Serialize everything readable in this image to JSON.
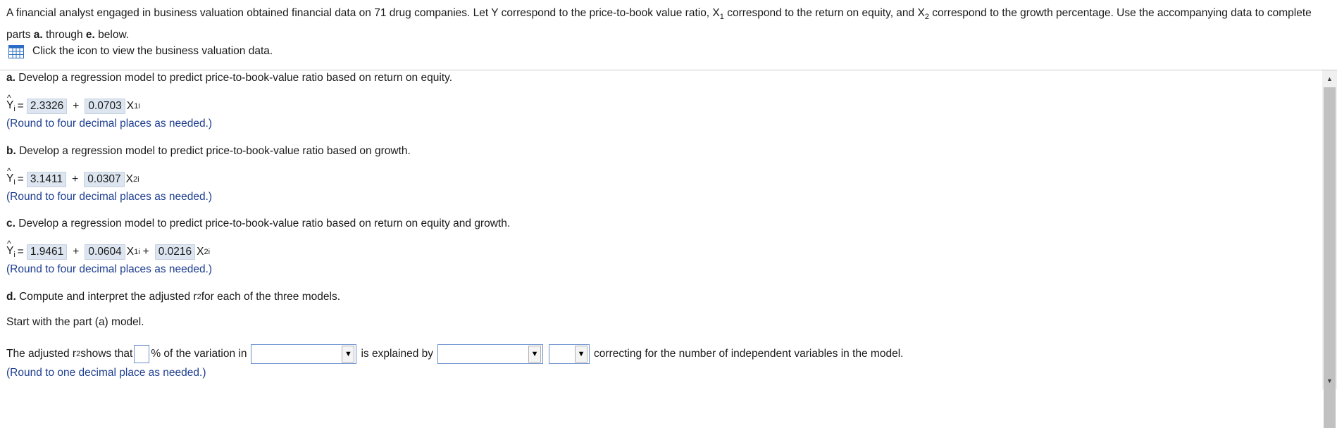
{
  "intro": {
    "text_part1": "A financial analyst engaged in business valuation obtained financial data on 71 drug companies. Let Y correspond to the price-to-book value ratio, X",
    "sub1": "1",
    "text_part2": " correspond to the return on equity, and X",
    "sub2": "2",
    "text_part3": " correspond to the growth percentage. Use the accompanying data to complete parts ",
    "bold_a": "a.",
    "text_part4": " through ",
    "bold_e": "e.",
    "text_part5": " below."
  },
  "data_link": {
    "icon": "table-grid-icon",
    "label": "Click the icon to view the business valuation data."
  },
  "part_a": {
    "label": "a.",
    "question": "Develop a regression model to predict price-to-book-value ratio based on return on equity.",
    "b0": "2.3326",
    "b1": "0.0703",
    "var1": "X",
    "var1_sub": "1i",
    "hint": "(Round to four decimal places as needed.)"
  },
  "part_b": {
    "label": "b.",
    "question": "Develop a regression model to predict price-to-book-value ratio based on growth.",
    "b0": "3.1411",
    "b1": "0.0307",
    "var1": "X",
    "var1_sub": "2i",
    "hint": "(Round to four decimal places as needed.)"
  },
  "part_c": {
    "label": "c.",
    "question": "Develop a regression model to predict price-to-book-value ratio based on return on equity and growth.",
    "b0": "1.9461",
    "b1": "0.0604",
    "var1": "X",
    "var1_sub": "1i",
    "b2": "0.0216",
    "var2": "X",
    "var2_sub": "2i",
    "hint": "(Round to four decimal places as needed.)"
  },
  "part_d": {
    "label": "d.",
    "question_pre": "Compute and interpret the adjusted r",
    "question_sup": "2",
    "question_post": " for each of the three models.",
    "start": "Start with the part (a) model.",
    "sentence_pre": "The adjusted r",
    "sentence_sup": "2",
    "sentence_mid1": " shows that",
    "sentence_mid2": "% of the variation in",
    "sentence_mid3": "is explained by",
    "sentence_post": "correcting for the number of independent variables in the model.",
    "dropdown1_value": "",
    "dropdown2_value": "",
    "dropdown3_value": "",
    "percent_value": "",
    "hint": "(Round to one decimal place as needed.)"
  },
  "symbols": {
    "yhat": "Y",
    "hat": "^",
    "yhat_sub": "i",
    "equals": "=",
    "plus": "+"
  },
  "colors": {
    "answer_bg": "#dde6f0",
    "hint_text": "#1c3d8f",
    "input_border": "#6b8fcf"
  }
}
